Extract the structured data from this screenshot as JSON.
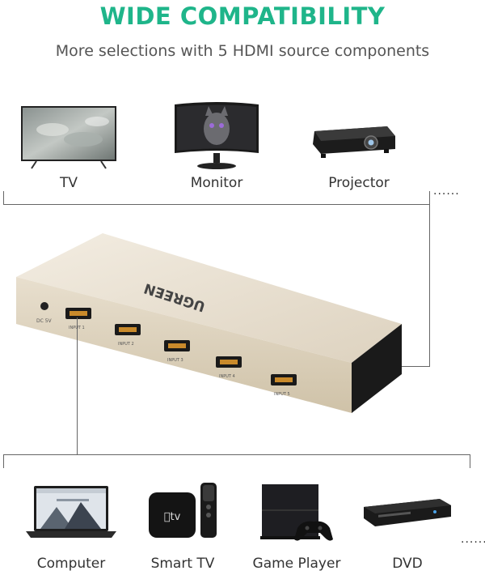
{
  "header": {
    "title": "WIDE COMPATIBILITY",
    "subtitle": "More selections with 5 HDMI source components"
  },
  "outputs": {
    "items": [
      {
        "label": "TV",
        "icon": "tv-icon"
      },
      {
        "label": "Monitor",
        "icon": "monitor-icon"
      },
      {
        "label": "Projector",
        "icon": "projector-icon"
      }
    ],
    "more": "......"
  },
  "device": {
    "brand": "UGREEN",
    "dc_label": "DC 5V",
    "ports": [
      "INPUT 1",
      "INPUT 2",
      "INPUT 3",
      "INPUT 4",
      "INPUT 5"
    ]
  },
  "inputs": {
    "items": [
      {
        "label": "Computer",
        "icon": "laptop-icon"
      },
      {
        "label": "Smart TV",
        "icon": "apple-tv-icon"
      },
      {
        "label": "Game Player",
        "icon": "game-console-icon"
      },
      {
        "label": "DVD",
        "icon": "dvd-player-icon"
      }
    ],
    "more": "......"
  },
  "colors": {
    "accent": "#1fb58a",
    "device_body": "#e6dccb"
  }
}
